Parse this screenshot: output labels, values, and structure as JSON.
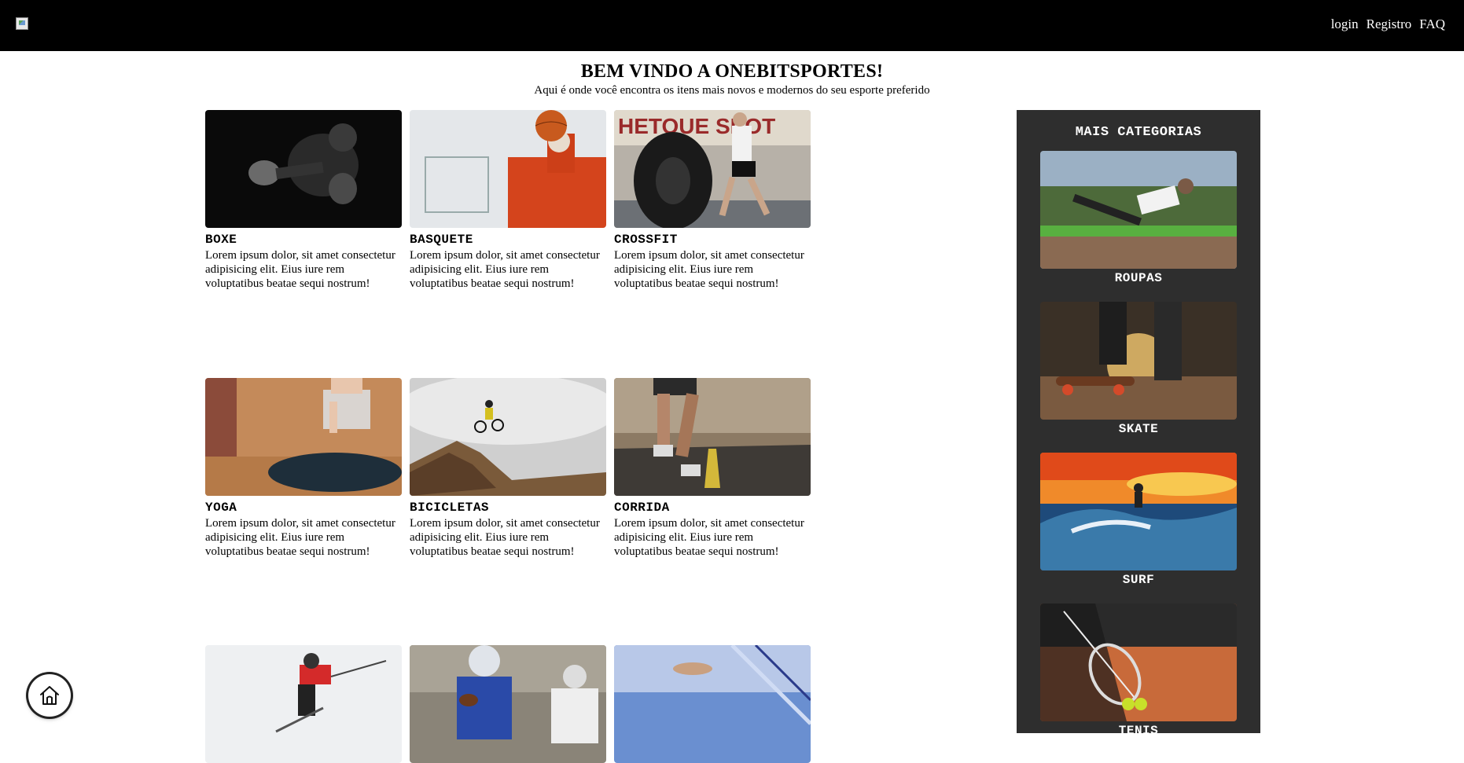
{
  "nav": {
    "links": [
      "login",
      "Registro",
      "FAQ"
    ]
  },
  "header": {
    "title": "BEM VINDO A ONEBITSPORTES!",
    "subtitle": "Aqui é onde você encontra os itens mais novos e modernos do seu esporte preferido"
  },
  "sports": [
    {
      "title": "BOXE",
      "desc": "Lorem ipsum dolor, sit amet consectetur adipisicing elit. Eius iure rem voluptatibus beatae sequi nostrum!"
    },
    {
      "title": "BASQUETE",
      "desc": "Lorem ipsum dolor, sit amet consectetur adipisicing elit. Eius iure rem voluptatibus beatae sequi nostrum!"
    },
    {
      "title": "CROSSFIT",
      "desc": "Lorem ipsum dolor, sit amet consectetur adipisicing elit. Eius iure rem voluptatibus beatae sequi nostrum!"
    },
    {
      "title": "YOGA",
      "desc": "Lorem ipsum dolor, sit amet consectetur adipisicing elit. Eius iure rem voluptatibus beatae sequi nostrum!"
    },
    {
      "title": "BICICLETAS",
      "desc": "Lorem ipsum dolor, sit amet consectetur adipisicing elit. Eius iure rem voluptatibus beatae sequi nostrum!"
    },
    {
      "title": "CORRIDA",
      "desc": "Lorem ipsum dolor, sit amet consectetur adipisicing elit. Eius iure rem voluptatibus beatae sequi nostrum!"
    }
  ],
  "sidebar": {
    "title": "MAIS CATEGORIAS",
    "categories": [
      "ROUPAS",
      "SKATE",
      "SURF",
      "TENIS"
    ]
  },
  "colors": {
    "topbar": "#000000",
    "sidebar": "#2e2e2e"
  }
}
